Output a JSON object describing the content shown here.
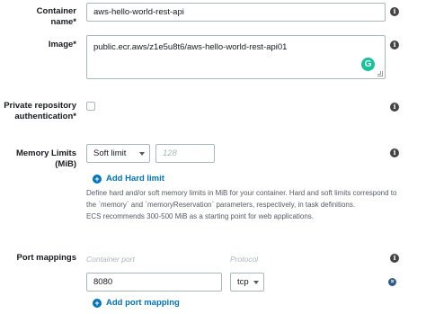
{
  "container_name": {
    "label": "Container name*",
    "value": "aws-hello-world-rest-api",
    "info_icon": "info-icon"
  },
  "image": {
    "label": "Image*",
    "value": "public.ecr.aws/z1e5u8t6/aws-hello-world-rest-api01",
    "grammarly_glyph": "G",
    "info_icon": "info-icon"
  },
  "private_repo": {
    "label_line1": "Private repository",
    "label_line2": "authentication*",
    "checked": false,
    "info_icon": "info-icon"
  },
  "memory_limits": {
    "label": "Memory Limits (MiB)",
    "limit_type": "Soft limit",
    "value_placeholder": "128",
    "add_hard_limit": "Add Hard limit",
    "help_line1": "Define hard and/or soft memory limits in MiB for your container. Hard and soft limits correspond to",
    "help_line2": "the `memory` and `memoryReservation` parameters, respectively, in task definitions.",
    "help_line3": "ECS recommends 300-500 MiB as a starting point for web applications.",
    "info_icon": "info-icon"
  },
  "port_mappings": {
    "label": "Port mappings",
    "container_port_header": "Container port",
    "protocol_header": "Protocol",
    "rows": [
      {
        "container_port": "8080",
        "protocol": "tcp"
      }
    ],
    "add_port_mapping": "Add port mapping",
    "info_icon": "info-icon"
  },
  "glyphs": {
    "info": "i",
    "plus": "+",
    "remove": "×"
  }
}
